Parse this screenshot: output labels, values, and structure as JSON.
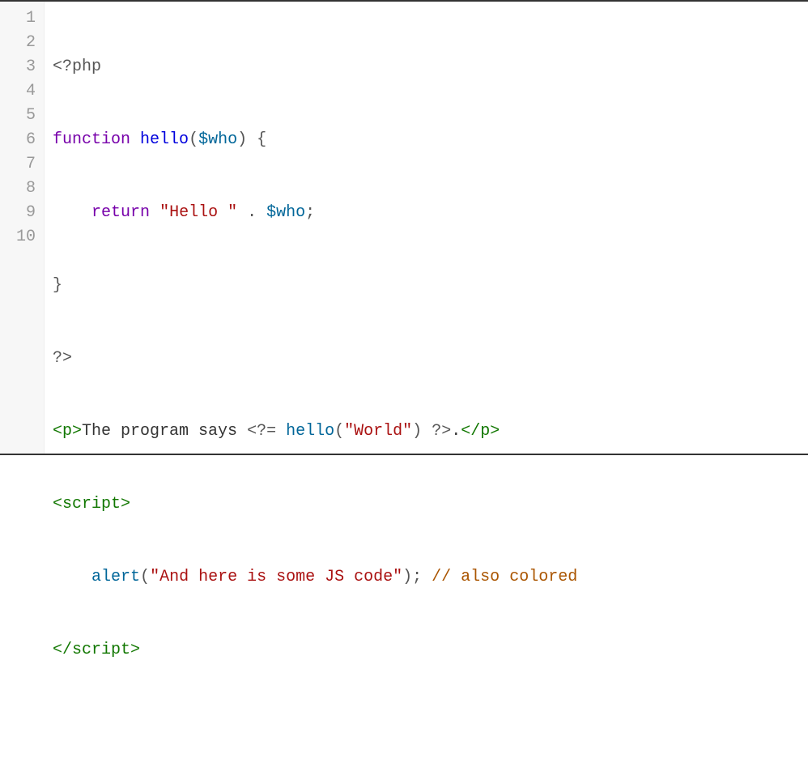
{
  "editor": {
    "lineNumbers": [
      "1",
      "2",
      "3",
      "4",
      "5",
      "6",
      "7",
      "8",
      "9",
      "10"
    ],
    "tokens": {
      "l1_phpopen": "<?php",
      "l2_function": "function",
      "l2_hello": "hello",
      "l2_paren1": "(",
      "l2_who": "$who",
      "l2_paren2": ")",
      "l2_brace": " {",
      "l3_indent": "    ",
      "l3_return": "return",
      "l3_sp1": " ",
      "l3_str": "\"Hello \"",
      "l3_sp2": " ",
      "l3_dot": ".",
      "l3_sp3": " ",
      "l3_who": "$who",
      "l3_semi": ";",
      "l4_brace": "}",
      "l5_phpclose": "?>",
      "l6_p_open": "<p>",
      "l6_text1": "The program says ",
      "l6_phpshort": "<?=",
      "l6_sp1": " ",
      "l6_hello": "hello",
      "l6_paren1": "(",
      "l6_world": "\"World\"",
      "l6_paren2": ")",
      "l6_sp2": " ",
      "l6_phpclose": "?>",
      "l6_dot": ".",
      "l6_p_close": "</p>",
      "l7_script_open": "<script>",
      "l8_indent": "    ",
      "l8_alert": "alert",
      "l8_paren1": "(",
      "l8_str": "\"And here is some JS code\"",
      "l8_paren2": ")",
      "l8_semi": ";",
      "l8_sp": " ",
      "l8_comment": "// also colored",
      "l9_script_close": "</script>"
    }
  }
}
